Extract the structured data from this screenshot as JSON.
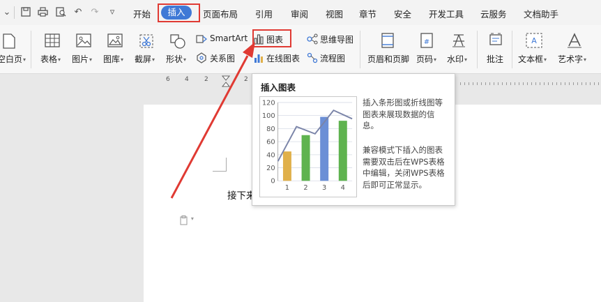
{
  "menubar": {
    "items": [
      "开始",
      "插入",
      "页面布局",
      "引用",
      "审阅",
      "视图",
      "章节",
      "安全",
      "开发工具",
      "云服务",
      "文档助手"
    ],
    "active": "插入"
  },
  "ribbon": {
    "blank_page": "空白页",
    "table": "表格",
    "picture": "图片",
    "gallery": "图库",
    "screenshot": "截屏",
    "shapes": "形状",
    "smartart": "SmartArt",
    "relationship": "关系图",
    "chart": "图表",
    "online_chart": "在线图表",
    "mindmap": "思维导图",
    "flowchart": "流程图",
    "header_footer": "页眉和页脚",
    "page_number": "页码",
    "watermark": "水印",
    "comment": "批注",
    "textbox": "文本框",
    "wordart": "艺术字"
  },
  "ruler": {
    "numbers": [
      "6",
      "4",
      "2",
      "2"
    ]
  },
  "document": {
    "text": "接下来"
  },
  "tooltip": {
    "title": "插入图表",
    "desc1": "插入条形图或折线图等图表来展现数据的信息。",
    "desc2": "兼容模式下插入的图表需要双击后在WPS表格中编辑，关闭WPS表格后即可正常显示。"
  },
  "chart_data": {
    "type": "bar",
    "categories": [
      "1",
      "2",
      "3",
      "4"
    ],
    "values": [
      45,
      70,
      98,
      92
    ],
    "line_values": [
      30,
      83,
      72,
      108,
      95
    ],
    "ylim": [
      0,
      120
    ],
    "yticks": [
      "0",
      "20",
      "40",
      "60",
      "80",
      "100",
      "120"
    ],
    "bar_colors": [
      "#e0b04a",
      "#5fb34f",
      "#6b8fd6",
      "#5fb34f"
    ],
    "line_color": "#7a84a8"
  },
  "colors": {
    "accent": "#3f79d6",
    "highlight": "#e03a33"
  }
}
